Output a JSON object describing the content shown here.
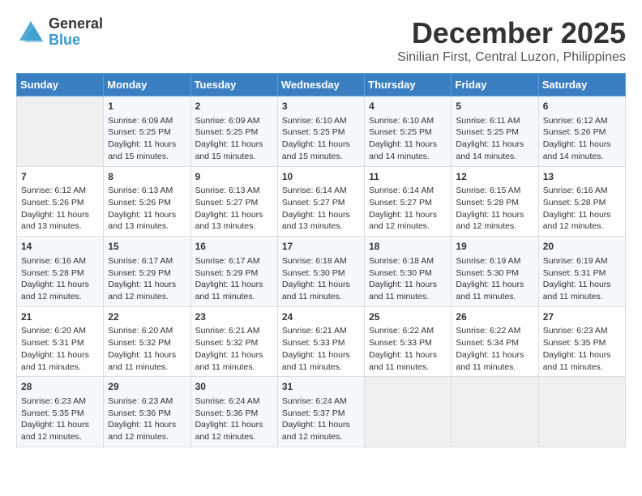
{
  "logo": {
    "general": "General",
    "blue": "Blue"
  },
  "title": "December 2025",
  "location": "Sinilian First, Central Luzon, Philippines",
  "days_of_week": [
    "Sunday",
    "Monday",
    "Tuesday",
    "Wednesday",
    "Thursday",
    "Friday",
    "Saturday"
  ],
  "weeks": [
    [
      {
        "day": "",
        "sunrise": "",
        "sunset": "",
        "daylight": ""
      },
      {
        "day": "1",
        "sunrise": "Sunrise: 6:09 AM",
        "sunset": "Sunset: 5:25 PM",
        "daylight": "Daylight: 11 hours and 15 minutes."
      },
      {
        "day": "2",
        "sunrise": "Sunrise: 6:09 AM",
        "sunset": "Sunset: 5:25 PM",
        "daylight": "Daylight: 11 hours and 15 minutes."
      },
      {
        "day": "3",
        "sunrise": "Sunrise: 6:10 AM",
        "sunset": "Sunset: 5:25 PM",
        "daylight": "Daylight: 11 hours and 15 minutes."
      },
      {
        "day": "4",
        "sunrise": "Sunrise: 6:10 AM",
        "sunset": "Sunset: 5:25 PM",
        "daylight": "Daylight: 11 hours and 14 minutes."
      },
      {
        "day": "5",
        "sunrise": "Sunrise: 6:11 AM",
        "sunset": "Sunset: 5:25 PM",
        "daylight": "Daylight: 11 hours and 14 minutes."
      },
      {
        "day": "6",
        "sunrise": "Sunrise: 6:12 AM",
        "sunset": "Sunset: 5:26 PM",
        "daylight": "Daylight: 11 hours and 14 minutes."
      }
    ],
    [
      {
        "day": "7",
        "sunrise": "Sunrise: 6:12 AM",
        "sunset": "Sunset: 5:26 PM",
        "daylight": "Daylight: 11 hours and 13 minutes."
      },
      {
        "day": "8",
        "sunrise": "Sunrise: 6:13 AM",
        "sunset": "Sunset: 5:26 PM",
        "daylight": "Daylight: 11 hours and 13 minutes."
      },
      {
        "day": "9",
        "sunrise": "Sunrise: 6:13 AM",
        "sunset": "Sunset: 5:27 PM",
        "daylight": "Daylight: 11 hours and 13 minutes."
      },
      {
        "day": "10",
        "sunrise": "Sunrise: 6:14 AM",
        "sunset": "Sunset: 5:27 PM",
        "daylight": "Daylight: 11 hours and 13 minutes."
      },
      {
        "day": "11",
        "sunrise": "Sunrise: 6:14 AM",
        "sunset": "Sunset: 5:27 PM",
        "daylight": "Daylight: 11 hours and 12 minutes."
      },
      {
        "day": "12",
        "sunrise": "Sunrise: 6:15 AM",
        "sunset": "Sunset: 5:28 PM",
        "daylight": "Daylight: 11 hours and 12 minutes."
      },
      {
        "day": "13",
        "sunrise": "Sunrise: 6:16 AM",
        "sunset": "Sunset: 5:28 PM",
        "daylight": "Daylight: 11 hours and 12 minutes."
      }
    ],
    [
      {
        "day": "14",
        "sunrise": "Sunrise: 6:16 AM",
        "sunset": "Sunset: 5:28 PM",
        "daylight": "Daylight: 11 hours and 12 minutes."
      },
      {
        "day": "15",
        "sunrise": "Sunrise: 6:17 AM",
        "sunset": "Sunset: 5:29 PM",
        "daylight": "Daylight: 11 hours and 12 minutes."
      },
      {
        "day": "16",
        "sunrise": "Sunrise: 6:17 AM",
        "sunset": "Sunset: 5:29 PM",
        "daylight": "Daylight: 11 hours and 11 minutes."
      },
      {
        "day": "17",
        "sunrise": "Sunrise: 6:18 AM",
        "sunset": "Sunset: 5:30 PM",
        "daylight": "Daylight: 11 hours and 11 minutes."
      },
      {
        "day": "18",
        "sunrise": "Sunrise: 6:18 AM",
        "sunset": "Sunset: 5:30 PM",
        "daylight": "Daylight: 11 hours and 11 minutes."
      },
      {
        "day": "19",
        "sunrise": "Sunrise: 6:19 AM",
        "sunset": "Sunset: 5:30 PM",
        "daylight": "Daylight: 11 hours and 11 minutes."
      },
      {
        "day": "20",
        "sunrise": "Sunrise: 6:19 AM",
        "sunset": "Sunset: 5:31 PM",
        "daylight": "Daylight: 11 hours and 11 minutes."
      }
    ],
    [
      {
        "day": "21",
        "sunrise": "Sunrise: 6:20 AM",
        "sunset": "Sunset: 5:31 PM",
        "daylight": "Daylight: 11 hours and 11 minutes."
      },
      {
        "day": "22",
        "sunrise": "Sunrise: 6:20 AM",
        "sunset": "Sunset: 5:32 PM",
        "daylight": "Daylight: 11 hours and 11 minutes."
      },
      {
        "day": "23",
        "sunrise": "Sunrise: 6:21 AM",
        "sunset": "Sunset: 5:32 PM",
        "daylight": "Daylight: 11 hours and 11 minutes."
      },
      {
        "day": "24",
        "sunrise": "Sunrise: 6:21 AM",
        "sunset": "Sunset: 5:33 PM",
        "daylight": "Daylight: 11 hours and 11 minutes."
      },
      {
        "day": "25",
        "sunrise": "Sunrise: 6:22 AM",
        "sunset": "Sunset: 5:33 PM",
        "daylight": "Daylight: 11 hours and 11 minutes."
      },
      {
        "day": "26",
        "sunrise": "Sunrise: 6:22 AM",
        "sunset": "Sunset: 5:34 PM",
        "daylight": "Daylight: 11 hours and 11 minutes."
      },
      {
        "day": "27",
        "sunrise": "Sunrise: 6:23 AM",
        "sunset": "Sunset: 5:35 PM",
        "daylight": "Daylight: 11 hours and 11 minutes."
      }
    ],
    [
      {
        "day": "28",
        "sunrise": "Sunrise: 6:23 AM",
        "sunset": "Sunset: 5:35 PM",
        "daylight": "Daylight: 11 hours and 12 minutes."
      },
      {
        "day": "29",
        "sunrise": "Sunrise: 6:23 AM",
        "sunset": "Sunset: 5:36 PM",
        "daylight": "Daylight: 11 hours and 12 minutes."
      },
      {
        "day": "30",
        "sunrise": "Sunrise: 6:24 AM",
        "sunset": "Sunset: 5:36 PM",
        "daylight": "Daylight: 11 hours and 12 minutes."
      },
      {
        "day": "31",
        "sunrise": "Sunrise: 6:24 AM",
        "sunset": "Sunset: 5:37 PM",
        "daylight": "Daylight: 11 hours and 12 minutes."
      },
      {
        "day": "",
        "sunrise": "",
        "sunset": "",
        "daylight": ""
      },
      {
        "day": "",
        "sunrise": "",
        "sunset": "",
        "daylight": ""
      },
      {
        "day": "",
        "sunrise": "",
        "sunset": "",
        "daylight": ""
      }
    ]
  ]
}
